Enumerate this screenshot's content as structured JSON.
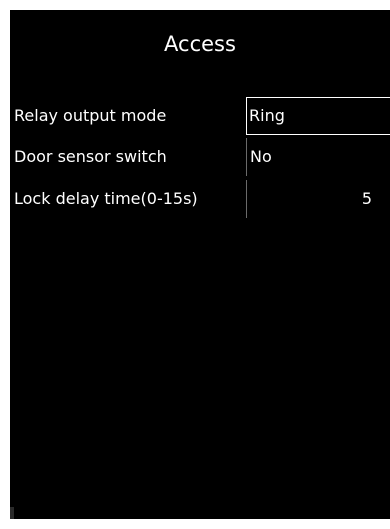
{
  "header": {
    "title": "Access"
  },
  "settings": [
    {
      "label": "Relay output mode",
      "value": "Ring"
    },
    {
      "label": "Door sensor switch",
      "value": "No"
    },
    {
      "label": "Lock delay time(0-15s)",
      "value": "5"
    }
  ],
  "colors": {
    "background": "#000000",
    "text": "#ffffff",
    "selection_border": "#ffffff",
    "divider": "#6a6a6a"
  }
}
